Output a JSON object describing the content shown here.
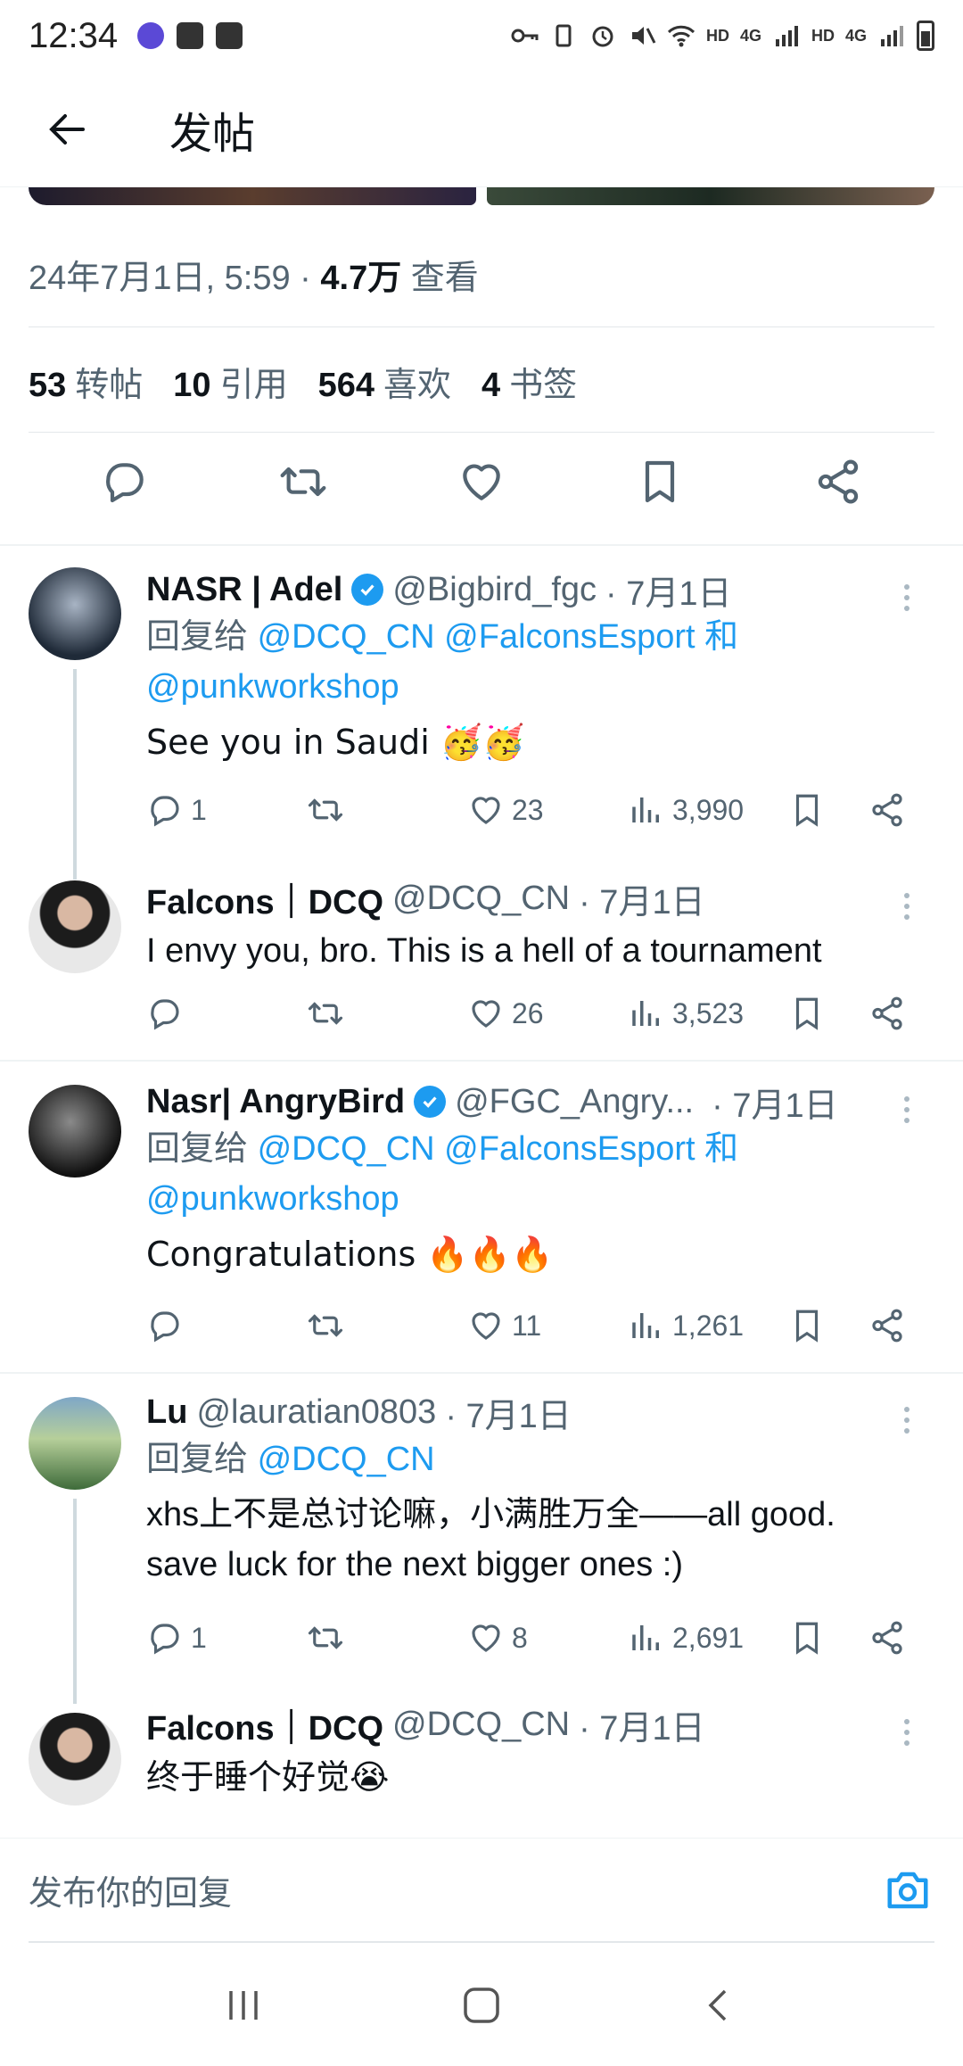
{
  "status_bar": {
    "time": "12:34",
    "hd1": "HD",
    "net1": "4G",
    "hd2": "HD",
    "net2": "4G"
  },
  "header": {
    "title": "发帖"
  },
  "post": {
    "timestamp": "24年7月1日, 5:59 · ",
    "views_count": "4.7万",
    "views_label": " 查看",
    "stats": [
      {
        "count": "53",
        "label": "转帖"
      },
      {
        "count": "10",
        "label": "引用"
      },
      {
        "count": "564",
        "label": "喜欢"
      },
      {
        "count": "4",
        "label": "书签"
      }
    ]
  },
  "replies": [
    {
      "name": "NASR | Adel",
      "verified": true,
      "handle": "@Bigbird_fgc",
      "date": "· 7月1日",
      "reply_prefix": "回复给 ",
      "reply_to": "@DCQ_CN @FalconsEsport",
      "reply_and": " 和",
      "reply_to2": "@punkworkshop",
      "text": "See you in Saudi 🥳🥳",
      "comments": "1",
      "likes": "23",
      "views": "3,990"
    },
    {
      "name": "Falcons｜DCQ",
      "verified": false,
      "handle": "@DCQ_CN",
      "date": "· 7月1日",
      "text": "I envy you, bro. This is a hell of a tournament",
      "comments": "",
      "likes": "26",
      "views": "3,523"
    },
    {
      "name": "Nasr| AngryBird",
      "verified": true,
      "handle": "@FGC_Angry...",
      "date": "· 7月1日",
      "reply_prefix": "回复给 ",
      "reply_to": "@DCQ_CN @FalconsEsport",
      "reply_and": " 和",
      "reply_to2": "@punkworkshop",
      "text": "Congratulations 🔥🔥🔥",
      "comments": "",
      "likes": "11",
      "views": "1,261"
    },
    {
      "name": "Lu",
      "verified": false,
      "handle": "@lauratian0803",
      "date": "· 7月1日",
      "reply_prefix": "回复给 ",
      "reply_to": "@DCQ_CN",
      "text": "xhs上不是总讨论嘛，小满胜万全——all good.",
      "text2": "save luck for the next bigger ones :)",
      "comments": "1",
      "likes": "8",
      "views": "2,691"
    },
    {
      "name": "Falcons｜DCQ",
      "verified": false,
      "handle": "@DCQ_CN",
      "date": "· 7月1日",
      "text": "终于睡个好觉😭"
    }
  ],
  "composer": {
    "placeholder": "发布你的回复"
  },
  "colors": {
    "accent": "#1d9bf0",
    "secondary_text": "#536471",
    "primary_text": "#0f1419"
  }
}
